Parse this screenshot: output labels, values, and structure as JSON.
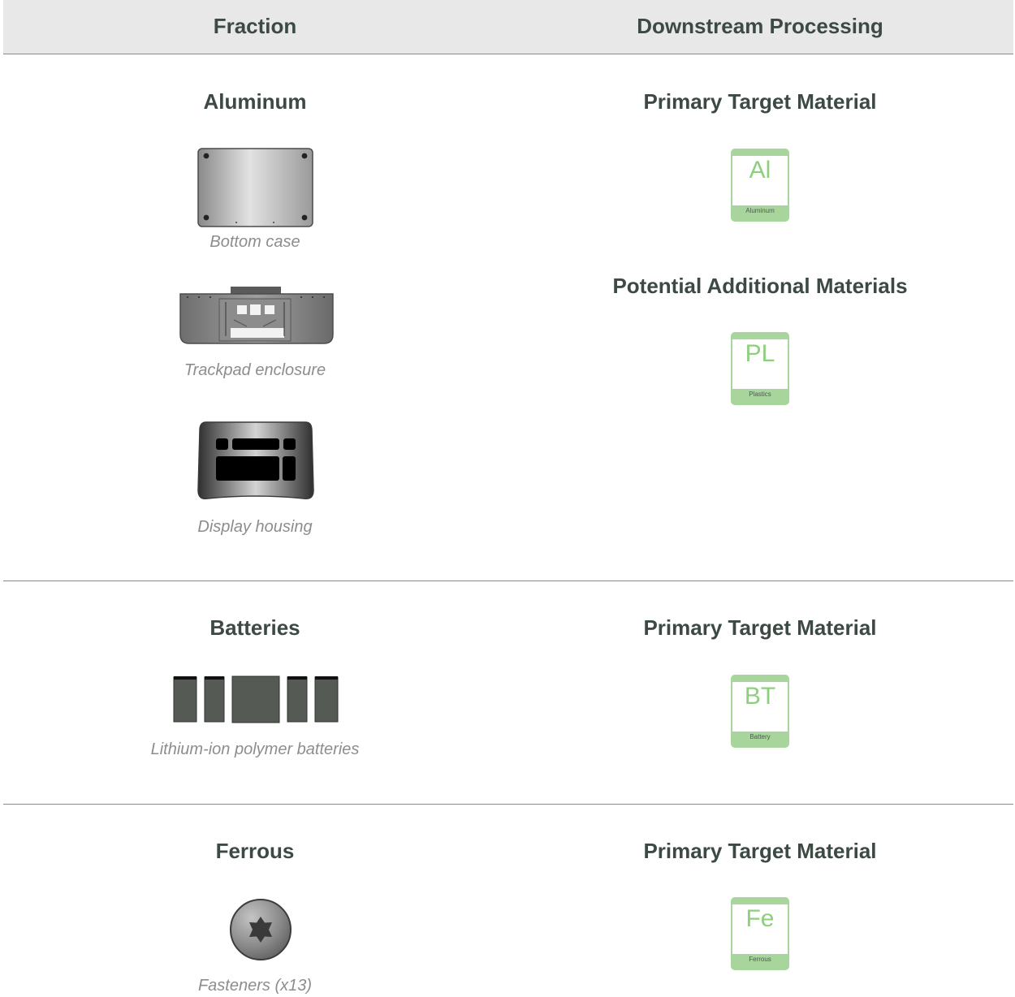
{
  "header": {
    "fraction": "Fraction",
    "downstream": "Downstream Processing"
  },
  "sections": [
    {
      "fraction": "Aluminum",
      "parts": [
        {
          "caption": "Bottom case",
          "icon": "bottom-case-image"
        },
        {
          "caption": "Trackpad enclosure",
          "icon": "trackpad-enclosure-image"
        },
        {
          "caption": "Display housing",
          "icon": "display-housing-image"
        }
      ],
      "primary_heading": "Primary Target Material",
      "primary_tile": {
        "symbol": "Al",
        "name": "Aluminum"
      },
      "additional_heading": "Potential Additional Materials",
      "additional_tile": {
        "symbol": "PL",
        "name": "Plastics"
      }
    },
    {
      "fraction": "Batteries",
      "parts": [
        {
          "caption": "Lithium-ion polymer batteries",
          "icon": "battery-cells-image"
        }
      ],
      "primary_heading": "Primary Target Material",
      "primary_tile": {
        "symbol": "BT",
        "name": "Battery"
      }
    },
    {
      "fraction": "Ferrous",
      "parts": [
        {
          "caption": "Fasteners (x13)",
          "icon": "screw-image"
        }
      ],
      "primary_heading": "Primary Target Material",
      "primary_tile": {
        "symbol": "Fe",
        "name": "Ferrous"
      }
    }
  ],
  "colors": {
    "heading_text": "#3d4a44",
    "caption_text": "#8d8d8d",
    "tile_green": "#a8d59b",
    "tile_symbol": "#8ecf7e",
    "header_bg": "#e8e8e8"
  }
}
